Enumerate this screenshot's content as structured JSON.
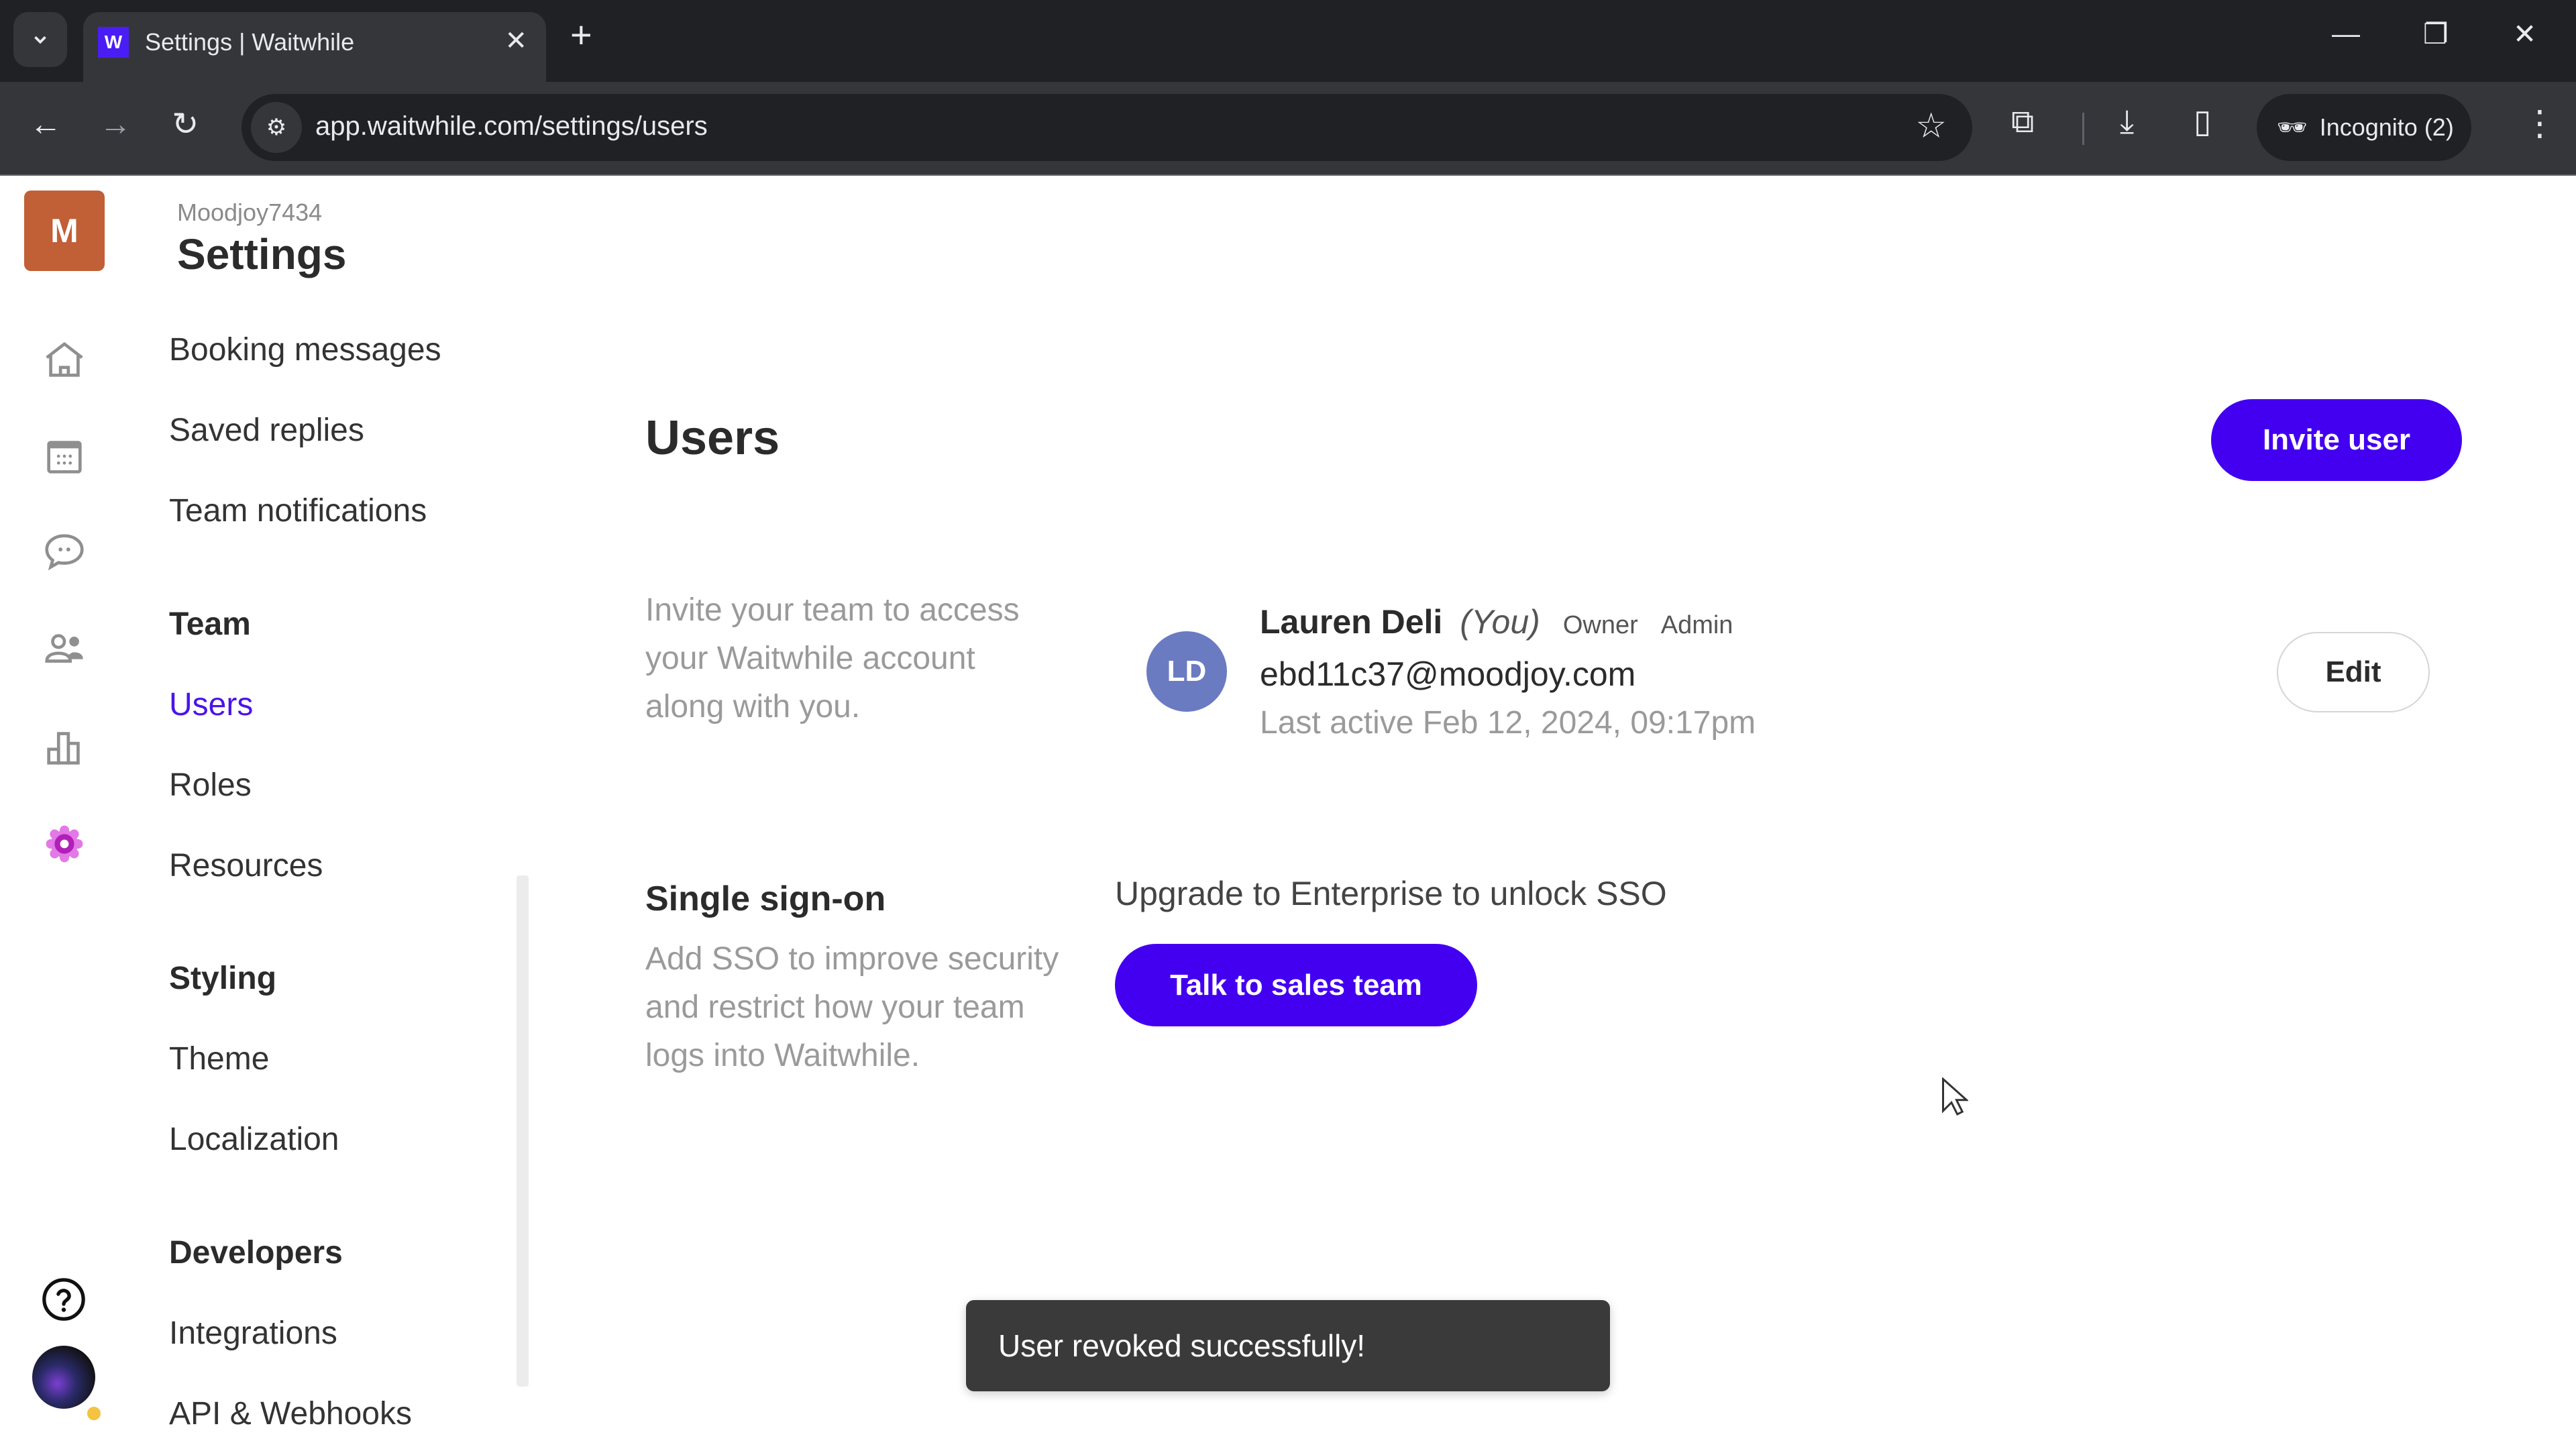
{
  "browser": {
    "tab_title": "Settings | Waitwhile",
    "favicon_letter": "W",
    "url": "app.waitwhile.com/settings/users",
    "incognito_label": "Incognito (2)",
    "icons": {
      "tab_search": "chevron-down-icon",
      "close_tab": "close-icon",
      "new_tab": "plus-icon",
      "back": "arrow-left-icon",
      "forward": "arrow-right-icon",
      "reload": "reload-icon",
      "site_info": "tune-icon",
      "bookmark": "star-icon",
      "extensions": "puzzle-icon",
      "downloads": "download-icon",
      "side_panel": "side-panel-icon",
      "incognito": "incognito-icon",
      "menu": "kebab-menu-icon",
      "minimize": "minimize-icon",
      "restore": "restore-icon",
      "close_window": "close-icon"
    }
  },
  "app": {
    "logo_letter": "M",
    "org_name": "Moodjoy7434",
    "section_title": "Settings",
    "rail_icons": [
      "home-icon",
      "calendar-icon",
      "chat-icon",
      "users-icon",
      "analytics-icon",
      "settings-icon"
    ],
    "rail_bottom_icons": [
      "help-icon",
      "profile-avatar"
    ],
    "accent_color": "#4300f0"
  },
  "settings_nav": {
    "items": [
      {
        "label": "Booking messages",
        "type": "item"
      },
      {
        "label": "Saved replies",
        "type": "item"
      },
      {
        "label": "Team notifications",
        "type": "item"
      },
      {
        "label": "Team",
        "type": "group"
      },
      {
        "label": "Users",
        "type": "item",
        "active": true
      },
      {
        "label": "Roles",
        "type": "item"
      },
      {
        "label": "Resources",
        "type": "item"
      },
      {
        "label": "Styling",
        "type": "group"
      },
      {
        "label": "Theme",
        "type": "item"
      },
      {
        "label": "Localization",
        "type": "item"
      },
      {
        "label": "Developers",
        "type": "group"
      },
      {
        "label": "Integrations",
        "type": "item"
      },
      {
        "label": "API & Webhooks",
        "type": "item"
      }
    ]
  },
  "main": {
    "title": "Users",
    "invite_button": "Invite user",
    "invite_description": "Invite your team to access your Waitwhile account along with you.",
    "users": [
      {
        "initials": "LD",
        "name": "Lauren Deli",
        "you_label": "(You)",
        "badges": [
          "Owner",
          "Admin"
        ],
        "email": "ebd11c37@moodjoy.com",
        "last_active": "Last active Feb 12, 2024, 09:17pm",
        "edit_label": "Edit"
      }
    ],
    "sso": {
      "title": "Single sign-on",
      "description": "Add SSO to improve security and restrict how your team logs into Waitwhile.",
      "upgrade_text": "Upgrade to Enterprise to unlock SSO",
      "button": "Talk to sales team"
    }
  },
  "toast": {
    "message": "User revoked successfully!"
  }
}
